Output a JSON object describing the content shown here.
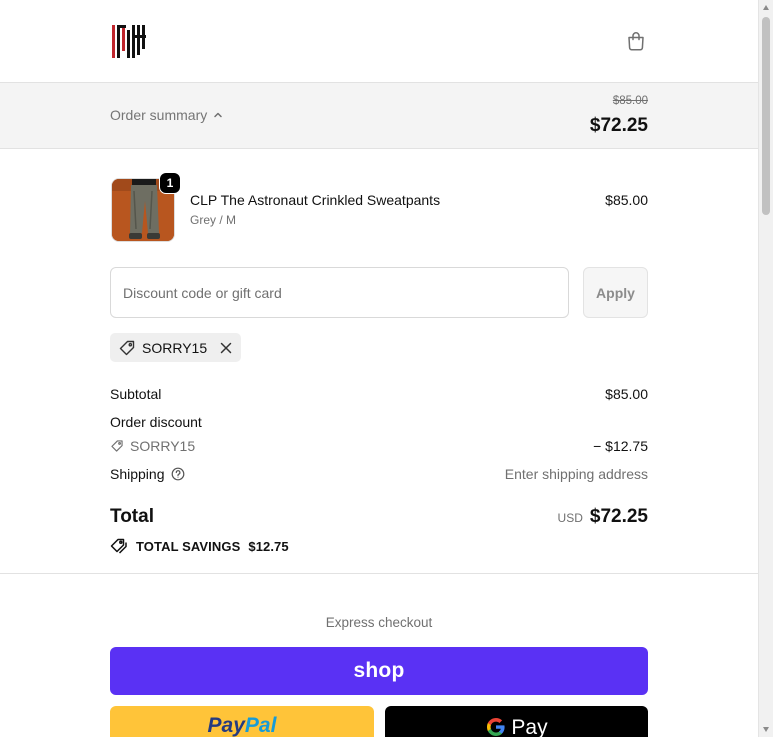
{
  "header": {
    "logo_name": "brand-logo",
    "cart_icon": "shopping-bag-icon"
  },
  "summary": {
    "toggle_label": "Order summary",
    "compare_at": "$85.00",
    "total": "$72.25"
  },
  "product": {
    "quantity": "1",
    "title": "CLP The Astronaut Crinkled Sweatpants",
    "variant": "Grey / M",
    "price": "$85.00"
  },
  "discount": {
    "placeholder": "Discount code or gift card",
    "apply_label": "Apply",
    "applied_code": "SORRY15"
  },
  "totals": {
    "subtotal_label": "Subtotal",
    "subtotal_value": "$85.00",
    "order_discount_label": "Order discount",
    "discount_code": "SORRY15",
    "discount_value": "− $12.75",
    "shipping_label": "Shipping",
    "shipping_value": "Enter shipping address",
    "total_label": "Total",
    "currency": "USD",
    "total_value": "$72.25",
    "savings_label": "TOTAL SAVINGS",
    "savings_value": "$12.75"
  },
  "express": {
    "title": "Express checkout",
    "shop_label": "shop",
    "paypal_label_a": "Pay",
    "paypal_label_b": "Pal",
    "gpay_label": "Pay"
  },
  "colors": {
    "shop_purple": "#5a31f4",
    "paypal_yellow": "#ffc439",
    "gpay_black": "#000000",
    "logo_red": "#c0262d"
  }
}
